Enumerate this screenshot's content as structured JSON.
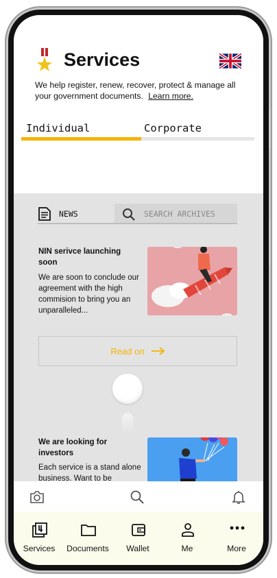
{
  "header": {
    "title": "Services",
    "intro": "We help register, renew, recover, protect & manage all your government documents.",
    "learn_more": "Learn more."
  },
  "tabs": [
    {
      "label": "Individual",
      "active": true
    },
    {
      "label": "Corporate",
      "active": false
    }
  ],
  "feed": {
    "section_label": "NEWS",
    "search_placeholder": "SEARCH ARCHIVES",
    "articles": [
      {
        "title": "NIN serivce launching soon",
        "excerpt": "We are soon to conclude our agreement with the high commision to bring you an unparalleled..."
      },
      {
        "title": "We are looking for investors",
        "excerpt": "Each service is a stand alone business. Want to be"
      }
    ],
    "read_on_label": "Read on"
  },
  "bottom_nav": [
    {
      "label": "Services",
      "icon": "services-icon"
    },
    {
      "label": "Documents",
      "icon": "folder-icon"
    },
    {
      "label": "Wallet",
      "icon": "wallet-icon"
    },
    {
      "label": "Me",
      "icon": "person-icon"
    },
    {
      "label": "More",
      "icon": "more-dots-icon"
    }
  ],
  "colors": {
    "accent": "#f5b400",
    "feed_background": "#e3e3e3",
    "nav_background": "#fbfcec"
  }
}
